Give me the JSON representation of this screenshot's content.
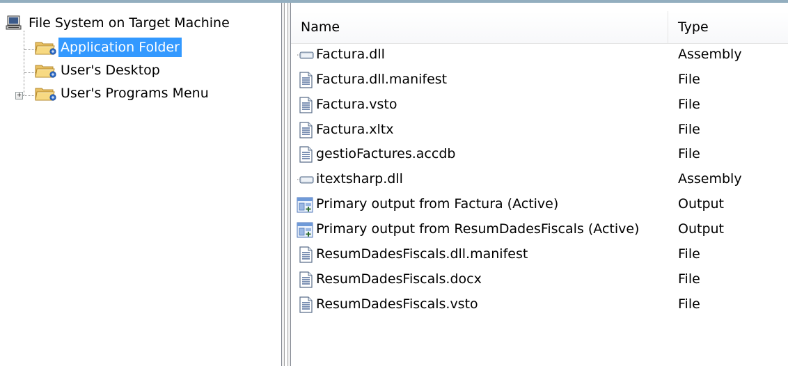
{
  "tree": {
    "root": {
      "label": "File System on Target Machine",
      "icon": "computer-icon"
    },
    "items": [
      {
        "label": "Application Folder",
        "icon": "folder-icon",
        "selected": true,
        "expandable": false
      },
      {
        "label": "User's Desktop",
        "icon": "folder-icon",
        "selected": false,
        "expandable": false
      },
      {
        "label": "User's Programs Menu",
        "icon": "folder-icon",
        "selected": false,
        "expandable": true,
        "expander_glyph": "+"
      }
    ]
  },
  "list": {
    "columns": {
      "name": "Name",
      "type": "Type"
    },
    "rows": [
      {
        "name": "Factura.dll",
        "type": "Assembly",
        "icon": "assembly-icon"
      },
      {
        "name": "Factura.dll.manifest",
        "type": "File",
        "icon": "file-icon"
      },
      {
        "name": "Factura.vsto",
        "type": "File",
        "icon": "file-icon"
      },
      {
        "name": "Factura.xltx",
        "type": "File",
        "icon": "file-icon"
      },
      {
        "name": "gestioFactures.accdb",
        "type": "File",
        "icon": "file-icon"
      },
      {
        "name": "itextsharp.dll",
        "type": "Assembly",
        "icon": "assembly-icon"
      },
      {
        "name": "Primary output from Factura (Active)",
        "type": "Output",
        "icon": "output-icon"
      },
      {
        "name": "Primary output from ResumDadesFiscals (Active)",
        "type": "Output",
        "icon": "output-icon"
      },
      {
        "name": "ResumDadesFiscals.dll.manifest",
        "type": "File",
        "icon": "file-icon"
      },
      {
        "name": "ResumDadesFiscals.docx",
        "type": "File",
        "icon": "file-icon"
      },
      {
        "name": "ResumDadesFiscals.vsto",
        "type": "File",
        "icon": "file-icon"
      }
    ]
  },
  "colors": {
    "selection": "#3399ff",
    "selection_text": "#ffffff",
    "top_border": "#93aebf",
    "splitter": "#f0f0f0"
  }
}
